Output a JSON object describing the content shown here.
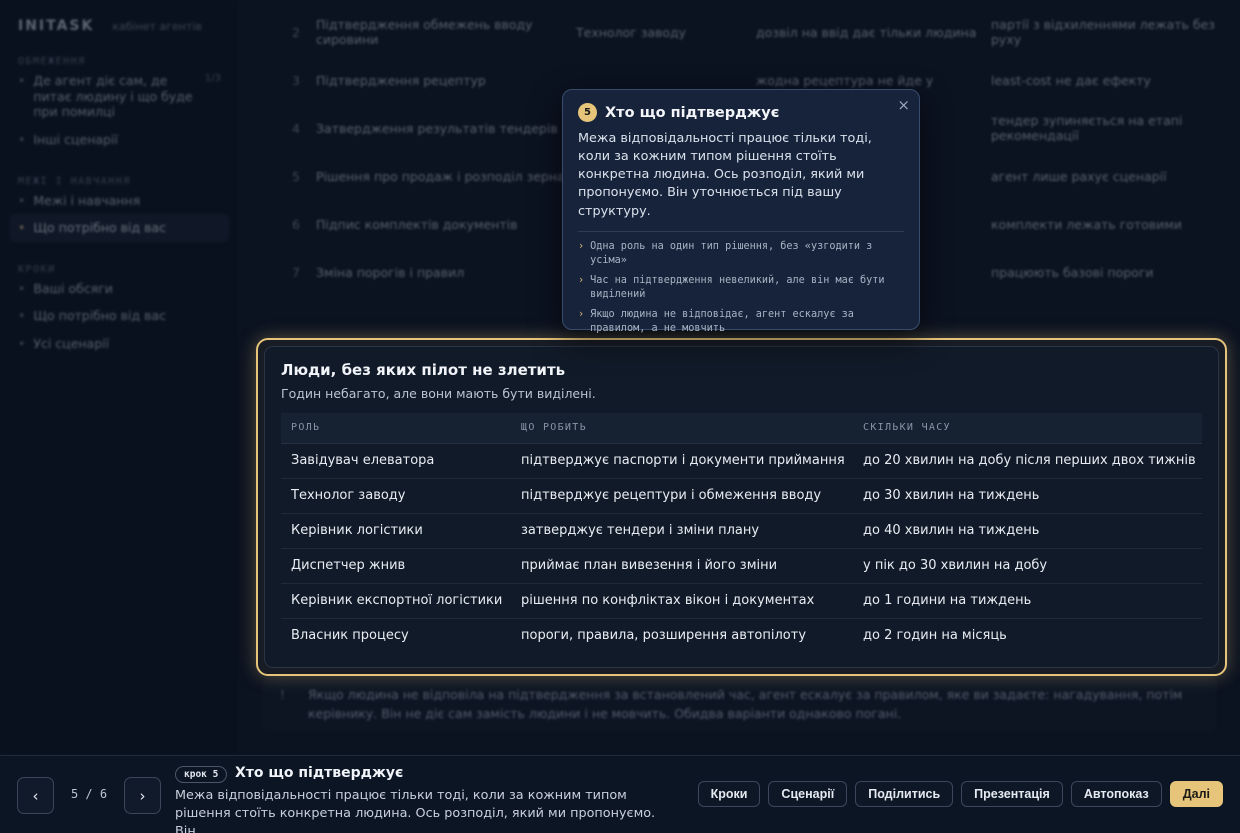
{
  "sidebar": {
    "brand": "INITASK",
    "brand_sub": "кабінет агентів",
    "sections": [
      {
        "title": "ОБМЕЖЕННЯ",
        "items": [
          {
            "label": "Де агент діє сам, де питає людину і що буде при помилці",
            "count": "1/3",
            "active": false
          },
          {
            "label": "Інші сценарії",
            "count": "",
            "active": false
          }
        ]
      },
      {
        "title": "МЕЖІ І НАВЧАННЯ",
        "items": [
          {
            "label": "Межі і навчання",
            "count": "",
            "active": false
          },
          {
            "label": "Що потрібно від вас",
            "count": "",
            "active": true
          }
        ]
      },
      {
        "title": "КРОКИ",
        "items": [
          {
            "label": "Ваші обсяги",
            "count": "",
            "active": false
          },
          {
            "label": "Що потрібно від вас",
            "count": "",
            "active": false
          },
          {
            "label": "Усі сценарії",
            "count": "",
            "active": false
          }
        ]
      }
    ]
  },
  "background_table": {
    "rows": [
      {
        "n": "2",
        "c1": "Підтвердження обмежень вводу сировини",
        "c2": "Технолог заводу",
        "c3": "дозвіл на ввід дає тільки людина",
        "c4": "партії з відхиленнями лежать без руху"
      },
      {
        "n": "3",
        "c1": "Підтвердження рецептур",
        "c2": "",
        "c3": "жодна рецептура не йде у",
        "c4": "least-cost не дає ефекту"
      },
      {
        "n": "4",
        "c1": "Затвердження результатів тендерів",
        "c2": "",
        "c3": "",
        "c4": "тендер зупиняється на етапі рекомендації"
      },
      {
        "n": "5",
        "c1": "Рішення про продаж і розподіл зерна",
        "c2": "",
        "c3": "",
        "c4": "агент лише рахує сценарії"
      },
      {
        "n": "6",
        "c1": "Підпис комплектів документів",
        "c2": "",
        "c3": "",
        "c4": "комплекти лежать готовими"
      },
      {
        "n": "7",
        "c1": "Зміна порогів і правил",
        "c2": "",
        "c3": "",
        "c4": "працюють базові пороги"
      }
    ]
  },
  "bg_note": {
    "index": "!",
    "text": "Якщо людина не відповіла на підтвердження за встановлений час, агент ескалує за правилом, яке ви задаєте: нагадування, потім керівнику. Він не діє сам замість людини і не мовчить. Обидва варіанти однаково погані."
  },
  "card": {
    "title": "Люди, без яких пілот не злетить",
    "subtitle": "Годин небагато, але вони мають бути виділені.",
    "columns": [
      "РОЛЬ",
      "ЩО РОБИТЬ",
      "СКІЛЬКИ ЧАСУ"
    ],
    "rows": [
      [
        "Завідувач елеватора",
        "підтверджує паспорти і документи приймання",
        "до 20 хвилин на добу після перших двох тижнів"
      ],
      [
        "Технолог заводу",
        "підтверджує рецептури і обмеження вводу",
        "до 30 хвилин на тиждень"
      ],
      [
        "Керівник логістики",
        "затверджує тендери і зміни плану",
        "до 40 хвилин на тиждень"
      ],
      [
        "Диспетчер жнив",
        "приймає план вивезення і його зміни",
        "у пік до 30 хвилин на добу"
      ],
      [
        "Керівник експортної логістики",
        "рішення по конфліктах вікон і документах",
        "до 1 години на тиждень"
      ],
      [
        "Власник процесу",
        "пороги, правила, розширення автопілоту",
        "до 2 годин на місяць"
      ]
    ]
  },
  "popover": {
    "step": "5",
    "title": "Хто що підтверджує",
    "close": "×",
    "body": "Межа відповідальності працює тільки тоді, коли за кожним типом рішення стоїть конкретна людина. Ось розподіл, який ми пропонуємо. Він уточнюється під вашу структуру.",
    "bullets": [
      "Одна роль на один тип рішення, без «узгодити з усіма»",
      "Час на підтвердження невеликий, але він має бути виділений",
      "Якщо людина не відповідає, агент ескалує за правилом, а не мовчить"
    ],
    "bullet_glyph": "›"
  },
  "bottombar": {
    "prev": "‹",
    "next": "›",
    "page": "5 / 6",
    "step_pill": "крок 5",
    "title": "Хто що підтверджує",
    "desc": "Межа відповідальності працює тільки тоді, коли за кожним типом рішення стоїть конкретна людина. Ось розподіл, який ми пропонуємо. Він...",
    "actions": [
      "Кроки",
      "Сценарії",
      "Поділитись",
      "Презентація",
      "Автопоказ"
    ],
    "primary": "Далі"
  },
  "colors": {
    "accent": "#e6c479",
    "background": "#0b1220",
    "panel": "#111a28",
    "popover": "#16233b"
  }
}
